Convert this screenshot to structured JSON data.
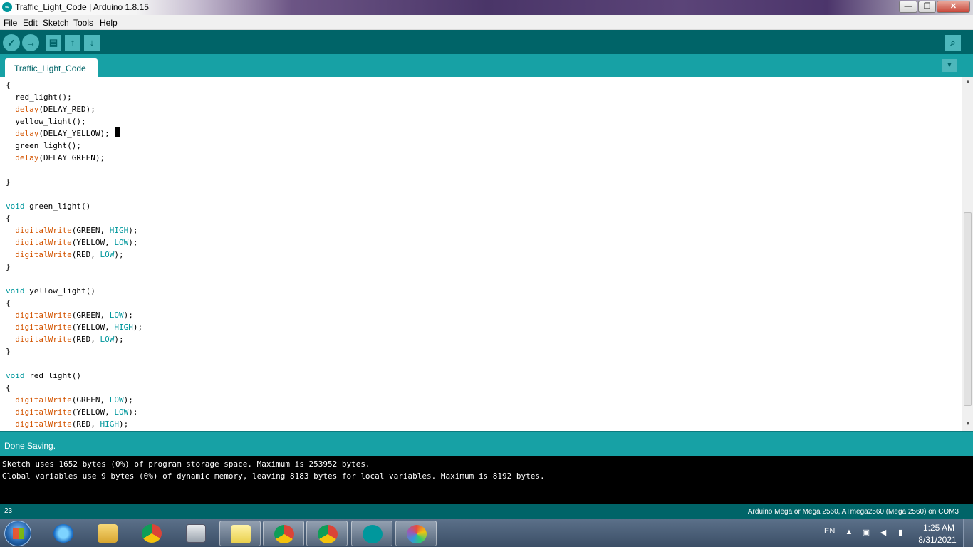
{
  "window": {
    "title": "Traffic_Light_Code | Arduino 1.8.15",
    "icon": "arduino-icon",
    "controls": {
      "minimize": "—",
      "maximize": "❐",
      "close": "✕"
    }
  },
  "menu": [
    "File",
    "Edit",
    "Sketch",
    "Tools",
    "Help"
  ],
  "toolbar": {
    "verify_icon": "✓",
    "upload_icon": "→",
    "new_icon": "▤",
    "open_icon": "↑",
    "save_icon": "↓",
    "serial_monitor_icon": "⌕"
  },
  "tabs": {
    "active": "Traffic_Light_Code",
    "menu_icon": "▼"
  },
  "editor": {
    "cursor_after_line": 4,
    "lines": [
      [
        {
          "t": "{",
          "c": ""
        }
      ],
      [
        {
          "t": "  red_light();",
          "c": ""
        }
      ],
      [
        {
          "t": "  ",
          "c": ""
        },
        {
          "t": "delay",
          "c": "kw-fn"
        },
        {
          "t": "(DELAY_RED);",
          "c": ""
        }
      ],
      [
        {
          "t": "  yellow_light();",
          "c": ""
        }
      ],
      [
        {
          "t": "  ",
          "c": ""
        },
        {
          "t": "delay",
          "c": "kw-fn"
        },
        {
          "t": "(DELAY_YELLOW);",
          "c": ""
        }
      ],
      [
        {
          "t": "  green_light();",
          "c": ""
        }
      ],
      [
        {
          "t": "  ",
          "c": ""
        },
        {
          "t": "delay",
          "c": "kw-fn"
        },
        {
          "t": "(DELAY_GREEN);",
          "c": ""
        }
      ],
      [
        {
          "t": "",
          "c": ""
        }
      ],
      [
        {
          "t": "}",
          "c": ""
        }
      ],
      [
        {
          "t": "",
          "c": ""
        }
      ],
      [
        {
          "t": "void",
          "c": "kw-type"
        },
        {
          "t": " green_light()",
          "c": ""
        }
      ],
      [
        {
          "t": "{",
          "c": ""
        }
      ],
      [
        {
          "t": "  ",
          "c": ""
        },
        {
          "t": "digitalWrite",
          "c": "kw-fn"
        },
        {
          "t": "(GREEN, ",
          "c": ""
        },
        {
          "t": "HIGH",
          "c": "kw-const"
        },
        {
          "t": ");",
          "c": ""
        }
      ],
      [
        {
          "t": "  ",
          "c": ""
        },
        {
          "t": "digitalWrite",
          "c": "kw-fn"
        },
        {
          "t": "(YELLOW, ",
          "c": ""
        },
        {
          "t": "LOW",
          "c": "kw-const"
        },
        {
          "t": ");",
          "c": ""
        }
      ],
      [
        {
          "t": "  ",
          "c": ""
        },
        {
          "t": "digitalWrite",
          "c": "kw-fn"
        },
        {
          "t": "(RED, ",
          "c": ""
        },
        {
          "t": "LOW",
          "c": "kw-const"
        },
        {
          "t": ");",
          "c": ""
        }
      ],
      [
        {
          "t": "}",
          "c": ""
        }
      ],
      [
        {
          "t": "",
          "c": ""
        }
      ],
      [
        {
          "t": "void",
          "c": "kw-type"
        },
        {
          "t": " yellow_light()",
          "c": ""
        }
      ],
      [
        {
          "t": "{",
          "c": ""
        }
      ],
      [
        {
          "t": "  ",
          "c": ""
        },
        {
          "t": "digitalWrite",
          "c": "kw-fn"
        },
        {
          "t": "(GREEN, ",
          "c": ""
        },
        {
          "t": "LOW",
          "c": "kw-const"
        },
        {
          "t": ");",
          "c": ""
        }
      ],
      [
        {
          "t": "  ",
          "c": ""
        },
        {
          "t": "digitalWrite",
          "c": "kw-fn"
        },
        {
          "t": "(YELLOW, ",
          "c": ""
        },
        {
          "t": "HIGH",
          "c": "kw-const"
        },
        {
          "t": ");",
          "c": ""
        }
      ],
      [
        {
          "t": "  ",
          "c": ""
        },
        {
          "t": "digitalWrite",
          "c": "kw-fn"
        },
        {
          "t": "(RED, ",
          "c": ""
        },
        {
          "t": "LOW",
          "c": "kw-const"
        },
        {
          "t": ");",
          "c": ""
        }
      ],
      [
        {
          "t": "}",
          "c": ""
        }
      ],
      [
        {
          "t": "",
          "c": ""
        }
      ],
      [
        {
          "t": "void",
          "c": "kw-type"
        },
        {
          "t": " red_light()",
          "c": ""
        }
      ],
      [
        {
          "t": "{",
          "c": ""
        }
      ],
      [
        {
          "t": "  ",
          "c": ""
        },
        {
          "t": "digitalWrite",
          "c": "kw-fn"
        },
        {
          "t": "(GREEN, ",
          "c": ""
        },
        {
          "t": "LOW",
          "c": "kw-const"
        },
        {
          "t": ");",
          "c": ""
        }
      ],
      [
        {
          "t": "  ",
          "c": ""
        },
        {
          "t": "digitalWrite",
          "c": "kw-fn"
        },
        {
          "t": "(YELLOW, ",
          "c": ""
        },
        {
          "t": "LOW",
          "c": "kw-const"
        },
        {
          "t": ");",
          "c": ""
        }
      ],
      [
        {
          "t": "  ",
          "c": ""
        },
        {
          "t": "digitalWrite",
          "c": "kw-fn"
        },
        {
          "t": "(RED, ",
          "c": ""
        },
        {
          "t": "HIGH",
          "c": "kw-const"
        },
        {
          "t": ");",
          "c": ""
        }
      ]
    ]
  },
  "status": {
    "message": "Done Saving."
  },
  "console": {
    "lines": [
      "Sketch uses 1652 bytes (0%) of program storage space. Maximum is 253952 bytes.",
      "Global variables use 9 bytes (0%) of dynamic memory, leaving 8183 bytes for local variables. Maximum is 8192 bytes."
    ]
  },
  "footer": {
    "line_number": "23",
    "board": "Arduino Mega or Mega 2560, ATmega2560 (Mega 2560) on COM3"
  },
  "taskbar": {
    "language": "EN",
    "time": "1:25 AM",
    "date": "8/31/2021",
    "apps": [
      {
        "name": "internet-explorer-icon",
        "open": false
      },
      {
        "name": "file-explorer-icon",
        "open": false
      },
      {
        "name": "chrome-icon",
        "open": false
      },
      {
        "name": "calculator-icon",
        "open": false
      },
      {
        "name": "sticky-notes-icon",
        "open": true
      },
      {
        "name": "chrome-profile-icon",
        "open": true
      },
      {
        "name": "chrome-profile-icon",
        "open": true
      },
      {
        "name": "arduino-icon",
        "open": true
      },
      {
        "name": "paint-icon",
        "open": true
      }
    ],
    "tray_icons": [
      "show-hidden-icons-icon",
      "network-icon",
      "volume-icon",
      "signal-icon"
    ]
  },
  "colors": {
    "toolbar": "#006468",
    "tabbar": "#17a1a5",
    "keyword_function": "#d35400",
    "keyword_type": "#00979c",
    "console_bg": "#000000"
  }
}
